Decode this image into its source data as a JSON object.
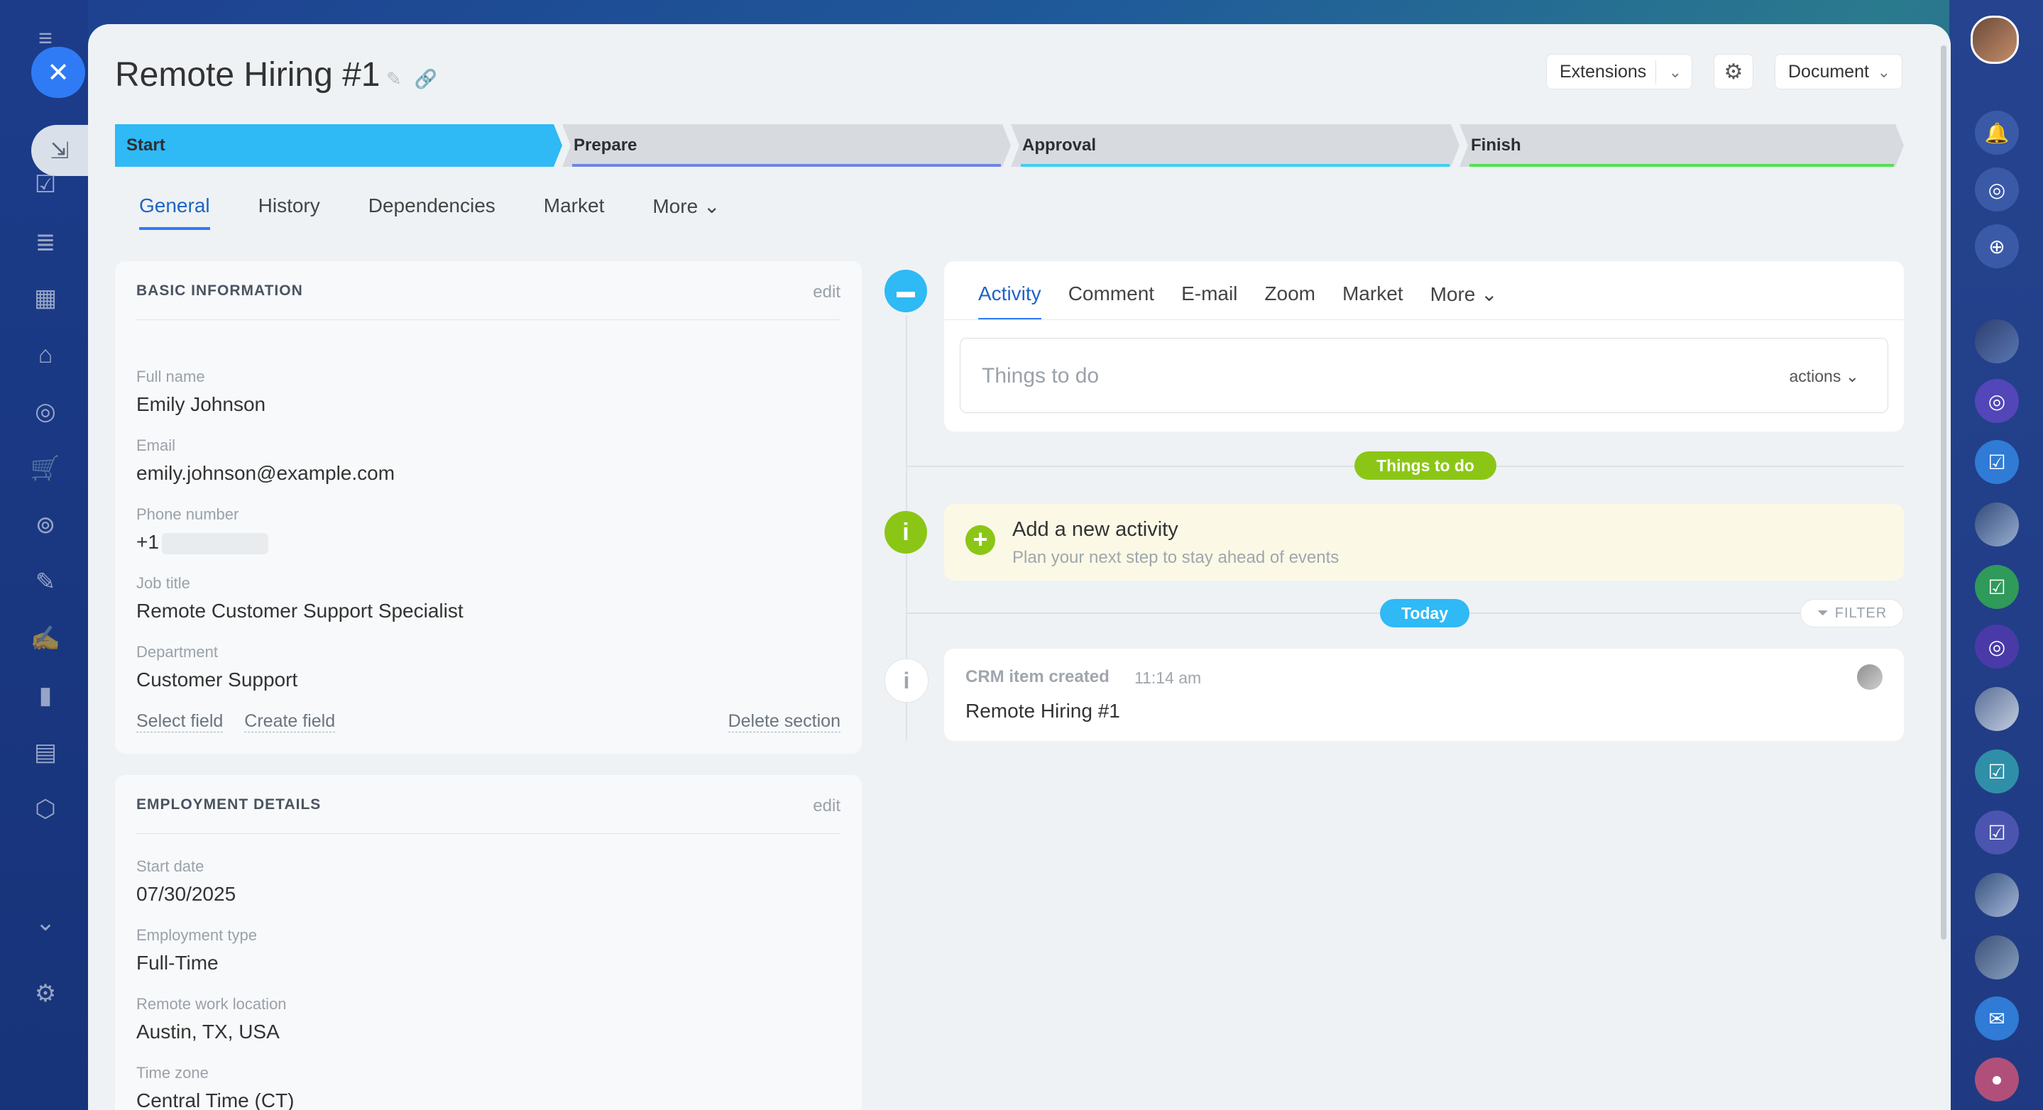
{
  "title": "Remote Hiring #1",
  "header": {
    "extensions_label": "Extensions",
    "document_label": "Document"
  },
  "stages": [
    {
      "label": "Start",
      "color": "#2fb9f5",
      "bar": "#2fb9f5"
    },
    {
      "label": "Prepare",
      "color": "#d7dbe0",
      "bar": "#6e86e3"
    },
    {
      "label": "Approval",
      "color": "#d7dbe0",
      "bar": "#3dd0f0"
    },
    {
      "label": "Finish",
      "color": "#d7dbe0",
      "bar": "#54e054"
    }
  ],
  "tabs": [
    "General",
    "History",
    "Dependencies",
    "Market",
    "More"
  ],
  "basic": {
    "heading": "BASIC INFORMATION",
    "edit": "edit",
    "fields": [
      {
        "label": "Full name",
        "value": "Emily Johnson"
      },
      {
        "label": "Email",
        "value": "emily.johnson@example.com"
      },
      {
        "label": "Phone number",
        "value": "+1"
      },
      {
        "label": "Job title",
        "value": "Remote Customer Support Specialist"
      },
      {
        "label": "Department",
        "value": "Customer Support"
      }
    ],
    "select_field": "Select field",
    "create_field": "Create field",
    "delete_section": "Delete section"
  },
  "employment": {
    "heading": "EMPLOYMENT DETAILS",
    "edit": "edit",
    "fields": [
      {
        "label": "Start date",
        "value": "07/30/2025"
      },
      {
        "label": "Employment type",
        "value": "Full-Time"
      },
      {
        "label": "Remote work location",
        "value": "Austin, TX, USA"
      },
      {
        "label": "Time zone",
        "value": "Central Time (CT)"
      }
    ]
  },
  "activity": {
    "tabs": [
      "Activity",
      "Comment",
      "E-mail",
      "Zoom",
      "Market",
      "More"
    ],
    "placeholder": "Things to do",
    "actions": "actions",
    "things_pill": "Things to do",
    "new_title": "Add a new activity",
    "new_sub": "Plan your next step to stay ahead of events",
    "today_pill": "Today",
    "filter": "FILTER",
    "crm_title": "CRM item created",
    "crm_time": "11:14 am",
    "crm_text": "Remote Hiring #1"
  },
  "colors": {
    "accent": "#2f7bf6",
    "green": "#8bc617",
    "cyan": "#2fb9f5"
  }
}
